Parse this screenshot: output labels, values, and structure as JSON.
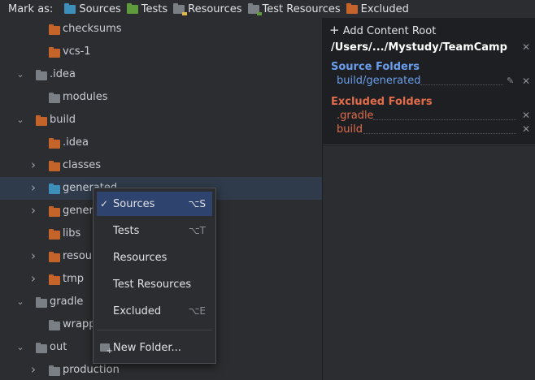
{
  "toolbar": {
    "mark_as": "Mark as:",
    "sources": "Sources",
    "tests": "Tests",
    "resources": "Resources",
    "test_resources": "Test Resources",
    "excluded": "Excluded"
  },
  "tree": {
    "items": [
      {
        "label": "checksums",
        "color": "orange",
        "expand": ""
      },
      {
        "label": "vcs-1",
        "color": "orange",
        "expand": ""
      },
      {
        "label": ".idea",
        "color": "gray",
        "expand": "expanded"
      },
      {
        "label": "modules",
        "color": "gray",
        "expand": ""
      },
      {
        "label": "build",
        "color": "orange",
        "expand": "expanded"
      },
      {
        "label": ".idea",
        "color": "orange",
        "expand": ""
      },
      {
        "label": "classes",
        "color": "orange",
        "expand": "collapsed"
      },
      {
        "label": "generated",
        "color": "blue",
        "expand": "collapsed"
      },
      {
        "label": "gener",
        "color": "orange",
        "expand": "collapsed"
      },
      {
        "label": "libs",
        "color": "orange",
        "expand": ""
      },
      {
        "label": "resou",
        "color": "orange",
        "expand": "collapsed"
      },
      {
        "label": "tmp",
        "color": "orange",
        "expand": "collapsed"
      },
      {
        "label": "gradle",
        "color": "gray",
        "expand": "expanded"
      },
      {
        "label": "wrapp",
        "color": "gray",
        "expand": ""
      },
      {
        "label": "out",
        "color": "gray",
        "expand": "expanded"
      },
      {
        "label": "production",
        "color": "gray",
        "expand": "collapsed"
      }
    ]
  },
  "content_root": {
    "add_label": "Add Content Root",
    "path": "/Users/.../Mystudy/TeamCamp",
    "source_title": "Source Folders",
    "source_folders": [
      "build/generated"
    ],
    "excluded_title": "Excluded Folders",
    "excluded_folders": [
      ".gradle",
      "build"
    ]
  },
  "menu": {
    "items": [
      {
        "label": "Sources",
        "shortcut": "⌥S",
        "checked": "✓"
      },
      {
        "label": "Tests",
        "shortcut": "⌥T",
        "checked": ""
      },
      {
        "label": "Resources",
        "shortcut": "",
        "checked": ""
      },
      {
        "label": "Test Resources",
        "shortcut": "",
        "checked": ""
      },
      {
        "label": "Excluded",
        "shortcut": "⌥E",
        "checked": ""
      }
    ],
    "new_folder": "New Folder..."
  },
  "colors": {
    "sources": "#3d8eb9",
    "tests": "#5f9a3c",
    "excluded": "#c4632a",
    "plain": "#7a7e85",
    "menu_highlight": "#2e436e",
    "source_text": "#6a9eec",
    "excluded_text": "#e06c4b"
  },
  "icons": {
    "folder": "folder-icon",
    "checkmark": "check-icon",
    "close": "close-icon",
    "edit": "pencil-icon",
    "add": "plus-icon"
  }
}
